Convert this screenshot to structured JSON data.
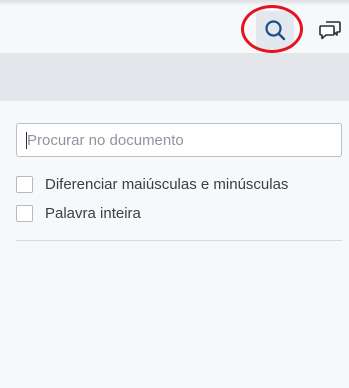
{
  "toolbar": {
    "search_button_icon": "search-icon",
    "comments_button_icon": "comments-icon",
    "highlight_color": "#e4141e"
  },
  "search_panel": {
    "input": {
      "placeholder": "Procurar no documento",
      "value": ""
    },
    "options": [
      {
        "label": "Diferenciar maiúsculas e minúsculas",
        "checked": false
      },
      {
        "label": "Palavra inteira",
        "checked": false
      }
    ]
  }
}
